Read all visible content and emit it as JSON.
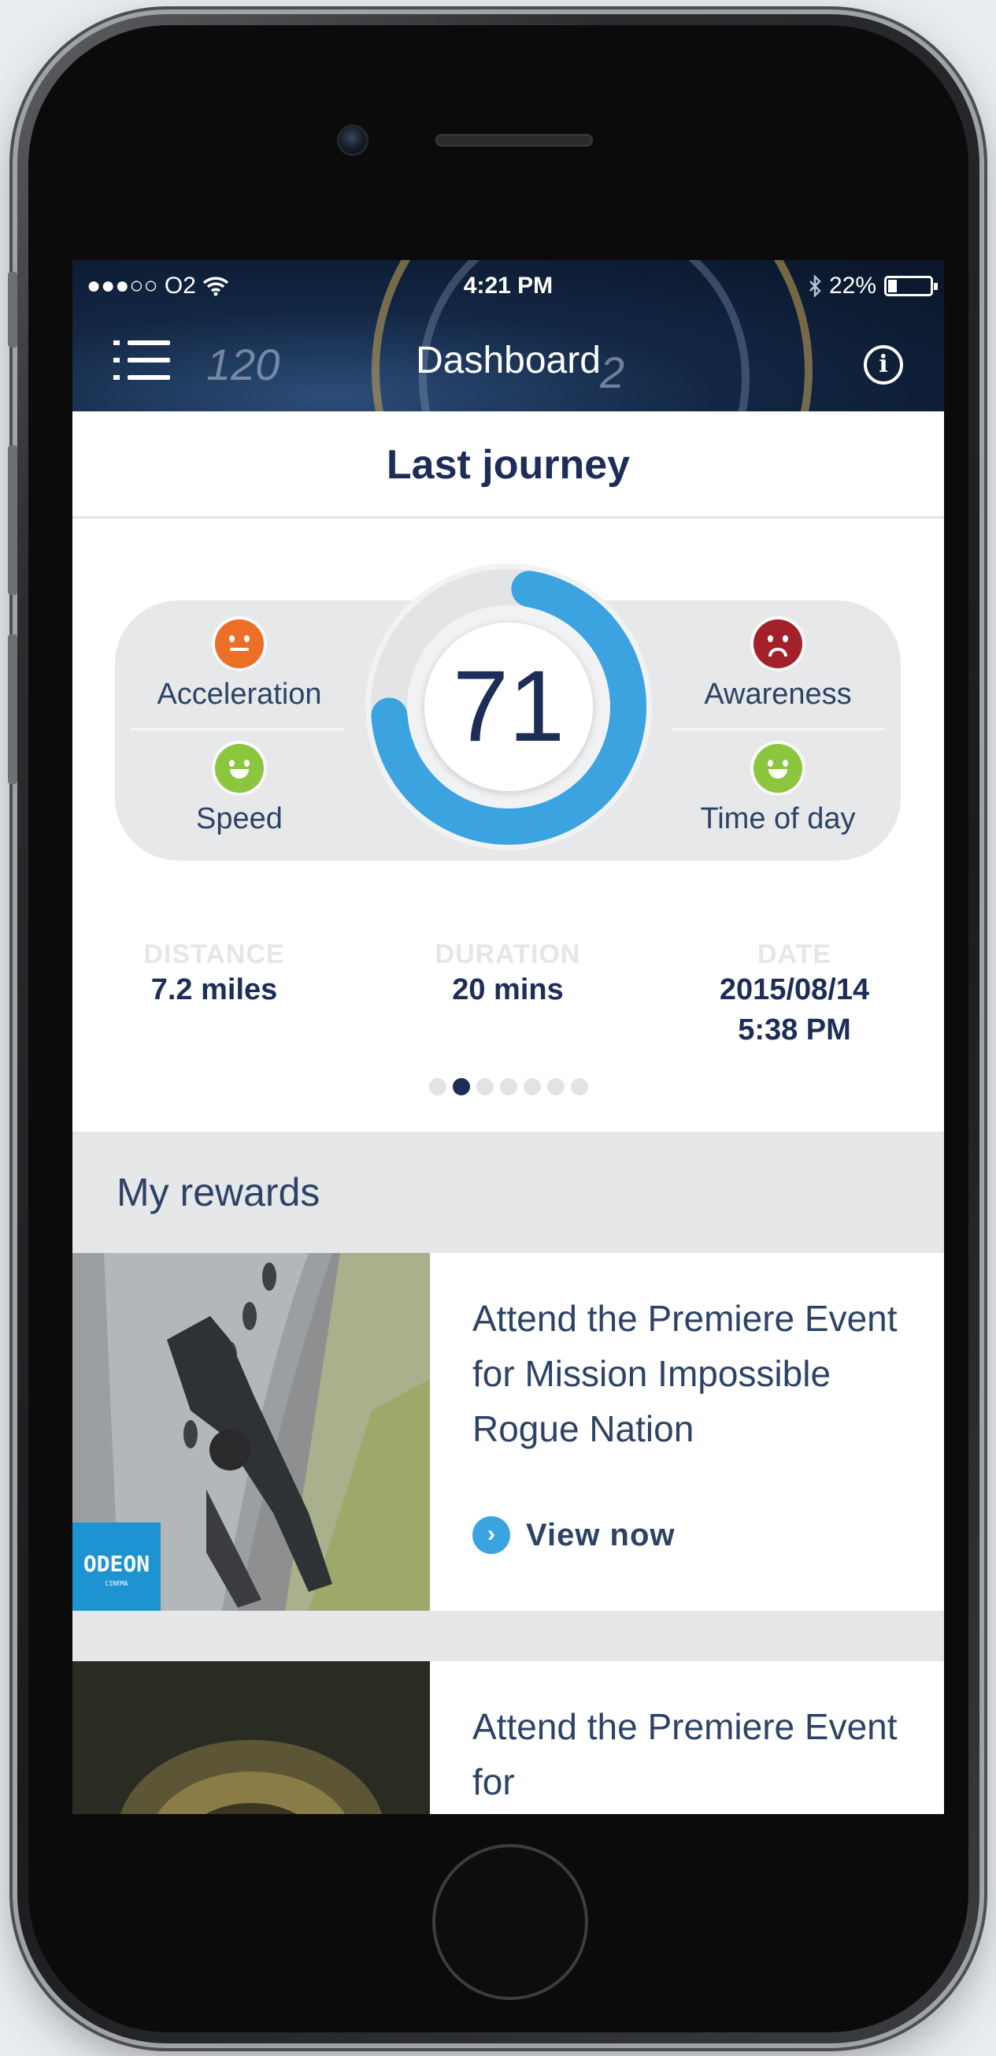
{
  "status_bar": {
    "carrier": "●●●○○ O2",
    "time": "4:21 PM",
    "battery": "22%",
    "battery_level": 0.22
  },
  "nav": {
    "title": "Dashboard",
    "menu_icon": "hamburger-menu-icon",
    "info_icon": "info-icon",
    "info_glyph": "i"
  },
  "background_dial": {
    "numbers": [
      "120",
      "2"
    ]
  },
  "last_journey": {
    "title": "Last journey",
    "score": "71",
    "score_fraction": 0.71,
    "categories": [
      {
        "label": "Acceleration",
        "rating": "neutral",
        "color": "#ec6f27"
      },
      {
        "label": "Speed",
        "rating": "happy",
        "color": "#8cc63f"
      },
      {
        "label": "Awareness",
        "rating": "sad",
        "color": "#a3212a"
      },
      {
        "label": "Time of day",
        "rating": "happy",
        "color": "#8cc63f"
      }
    ],
    "stats": [
      {
        "label": "DISTANCE",
        "value": "7.2 miles"
      },
      {
        "label": "DURATION",
        "value": "20 mins"
      },
      {
        "label": "DATE",
        "value": "2015/08/14",
        "value2": "5:38 PM"
      }
    ],
    "pagination": {
      "total": 7,
      "active": 1
    }
  },
  "rewards": {
    "title": "My rewards",
    "items": [
      {
        "title": "Attend the Premiere Event for Mission Impossible Rogue Nation",
        "cta": "View now",
        "cta_icon": "chevron-right-icon",
        "brand": "ODEON"
      },
      {
        "title": "Attend the Premiere Event for"
      }
    ]
  },
  "colors": {
    "navy": "#1c2d57",
    "accent_blue": "#3ba4e0",
    "gauge_track": "#e3e4e6"
  }
}
